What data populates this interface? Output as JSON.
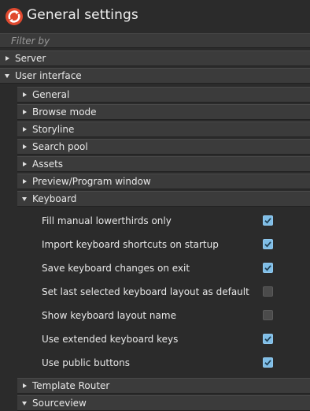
{
  "window": {
    "title": "General settings"
  },
  "filter": {
    "placeholder": "Filter by"
  },
  "sections": [
    {
      "label": "Server",
      "expanded": false
    },
    {
      "label": "User interface",
      "expanded": true
    }
  ],
  "ui_subsections": [
    {
      "label": "General",
      "expanded": false
    },
    {
      "label": "Browse mode",
      "expanded": false
    },
    {
      "label": "Storyline",
      "expanded": false
    },
    {
      "label": "Search pool",
      "expanded": false
    },
    {
      "label": "Assets",
      "expanded": false
    },
    {
      "label": "Preview/Program window",
      "expanded": false
    },
    {
      "label": "Keyboard",
      "expanded": true
    }
  ],
  "keyboard_options": [
    {
      "label": "Fill manual lowerthirds only",
      "checked": true
    },
    {
      "label": "Import keyboard shortcuts on startup",
      "checked": true
    },
    {
      "label": "Save keyboard changes on exit",
      "checked": true
    },
    {
      "label": "Set last selected keyboard layout as default",
      "checked": false
    },
    {
      "label": "Show keyboard layout name",
      "checked": false
    },
    {
      "label": "Use extended keyboard keys",
      "checked": true
    },
    {
      "label": "Use public buttons",
      "checked": true
    }
  ],
  "ui_subsections_after": [
    {
      "label": "Template Router",
      "expanded": false
    },
    {
      "label": "Sourceview",
      "expanded": true
    }
  ],
  "colors": {
    "background": "#2b2b2b",
    "row": "#3b3b3b",
    "checkbox_on": "#7fbde6",
    "checkbox_off": "#4b4b4b",
    "logo_red": "#e0492f"
  },
  "icons": {
    "logo": "app-logo-icon",
    "collapsed": "triangle-right-icon",
    "expanded": "triangle-down-icon",
    "check": "checkmark-icon"
  }
}
